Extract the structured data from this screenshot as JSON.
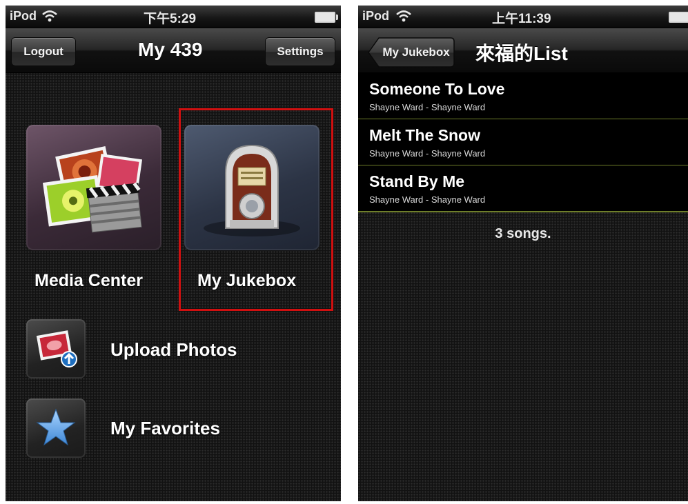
{
  "left_screen": {
    "status_bar": {
      "carrier": "iPod",
      "time": "下午5:29"
    },
    "nav": {
      "logout_label": "Logout",
      "title": "My 439",
      "settings_label": "Settings"
    },
    "tiles": [
      {
        "label": "Media Center"
      },
      {
        "label": "My Jukebox"
      }
    ],
    "rows": [
      {
        "label": "Upload Photos"
      },
      {
        "label": "My Favorites"
      }
    ]
  },
  "right_screen": {
    "status_bar": {
      "carrier": "iPod",
      "time": "上午11:39"
    },
    "nav": {
      "back_label": "My Jukebox",
      "title": "來福的List"
    },
    "songs": [
      {
        "title": "Someone To Love",
        "subtitle": "Shayne Ward - Shayne Ward"
      },
      {
        "title": "Melt The Snow",
        "subtitle": "Shayne Ward - Shayne Ward"
      },
      {
        "title": "Stand By Me",
        "subtitle": "Shayne Ward - Shayne Ward"
      }
    ],
    "count_text": "3 songs."
  },
  "colors": {
    "highlight": "#d01010",
    "row_separator": "#6f7f2a"
  }
}
